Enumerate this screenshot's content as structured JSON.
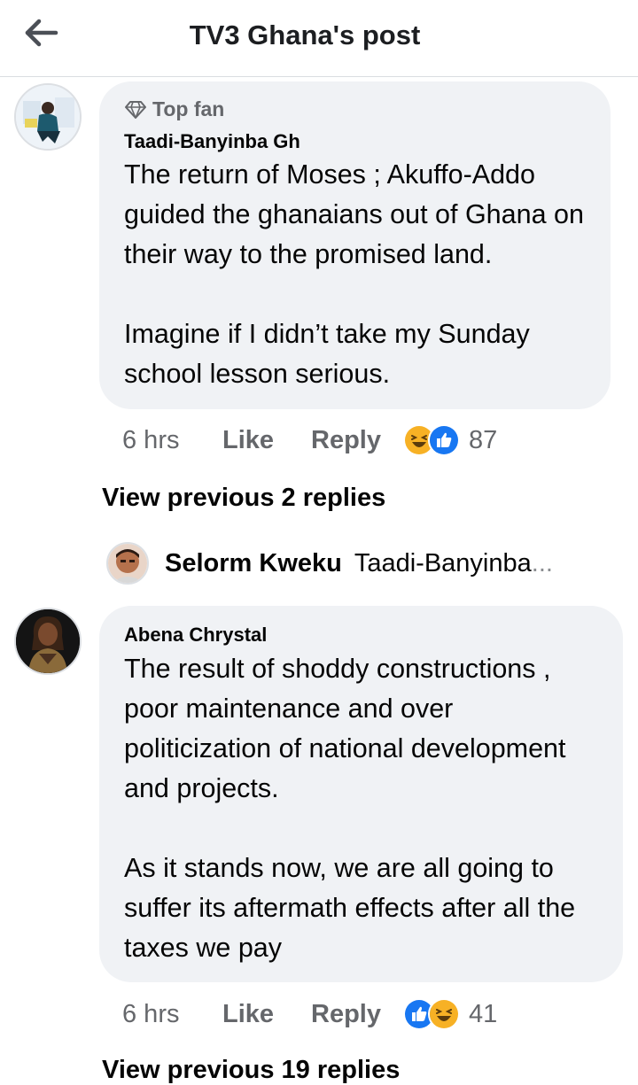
{
  "header": {
    "title": "TV3 Ghana's post"
  },
  "comments": [
    {
      "badge": "Top fan",
      "author": "Taadi-Banyinba Gh",
      "text": "The return of Moses ; Akuffo-Addo guided the ghanaians out of Ghana on their way to the promised land.\n\nImagine if I didn’t take my Sunday school lesson serious.",
      "time": "6 hrs",
      "like": "Like",
      "reply": "Reply",
      "reactions": [
        "haha-icon",
        "like-icon"
      ],
      "reaction_count": "87",
      "view_previous": "View previous 2 replies",
      "reply_preview": {
        "name": "Selorm Kweku",
        "text": "Taadi-Banyinba",
        "ellipsis": "..."
      }
    },
    {
      "author": "Abena Chrystal",
      "text": "The result of shoddy constructions , poor maintenance and over politicization of national development and projects.\n\nAs it stands now, we are all going to suffer its aftermath effects after all the taxes we pay",
      "time": "6 hrs",
      "like": "Like",
      "reply": "Reply",
      "reactions": [
        "like-icon",
        "haha-icon"
      ],
      "reaction_count": "41",
      "view_previous": "View previous 19 replies"
    }
  ],
  "colors": {
    "like_blue": "#1877f2",
    "haha_yellow": "#f7b125",
    "bubble": "#f0f2f5",
    "secondary_text": "#65676b"
  }
}
